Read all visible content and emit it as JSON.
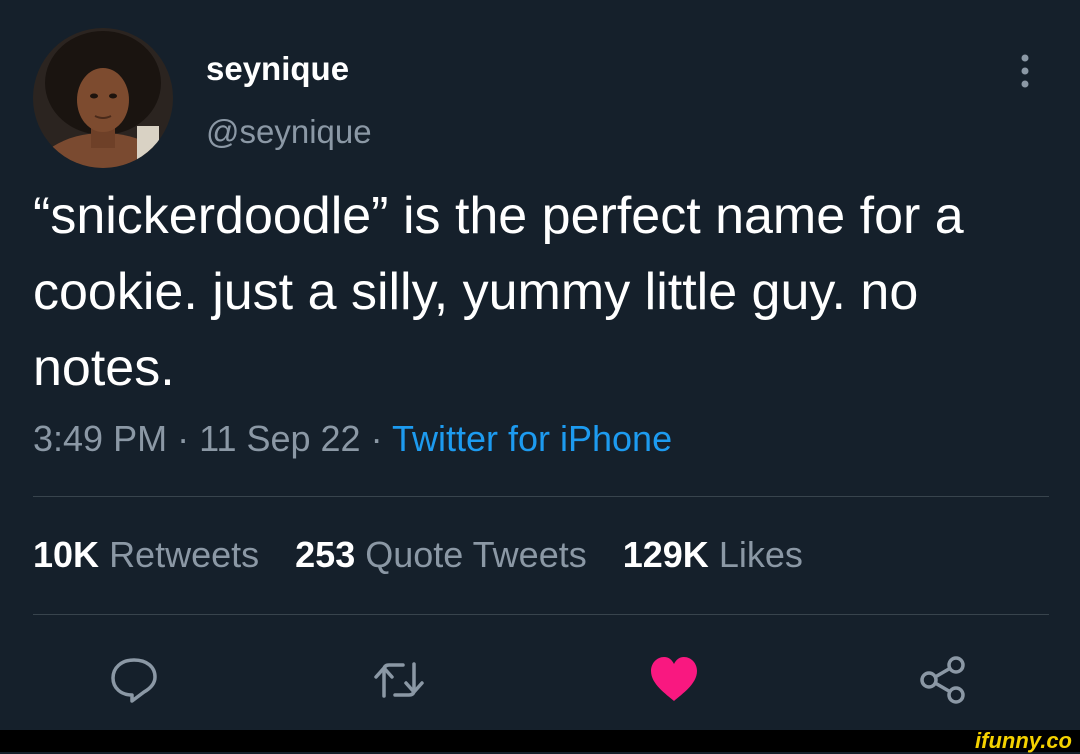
{
  "author": {
    "display_name": "seynique",
    "handle": "@seynique"
  },
  "tweet": {
    "text": "“snickerdoodle” is the perfect name for a cookie. just a silly, yummy little guy. no notes.",
    "time": "3:49 PM",
    "date": "11 Sep 22",
    "separator": "·",
    "source": "Twitter for iPhone"
  },
  "stats": [
    {
      "count": "10K",
      "label": "Retweets"
    },
    {
      "count": "253",
      "label": "Quote Tweets"
    },
    {
      "count": "129K",
      "label": "Likes"
    }
  ],
  "actions": {
    "reply_icon": "speech-bubble-icon",
    "retweet_icon": "retweet-arrows-icon",
    "like_icon": "heart-icon",
    "share_icon": "share-nodes-icon"
  },
  "colors": {
    "background": "#15202b",
    "primary_text": "#ffffff",
    "secondary_text": "#8b98a5",
    "link": "#1d9bf0",
    "like_active": "#f91880"
  },
  "watermark": "ifunny.co"
}
